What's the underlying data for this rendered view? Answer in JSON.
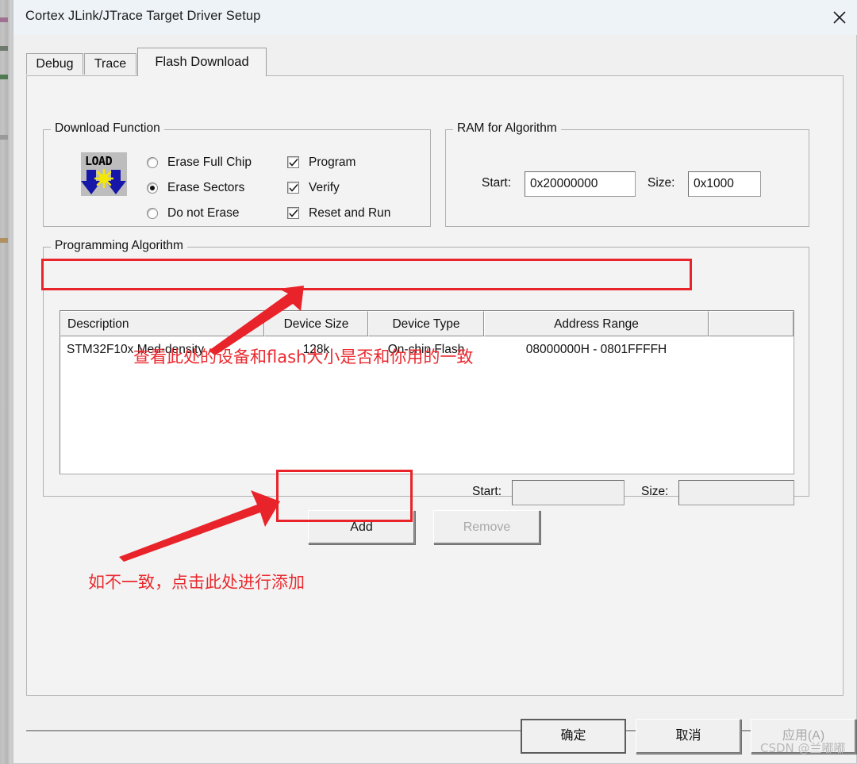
{
  "window": {
    "title": "Cortex JLink/JTrace Target Driver Setup",
    "close_icon": "close-icon"
  },
  "tabs": [
    {
      "label": "Debug",
      "active": false
    },
    {
      "label": "Trace",
      "active": false
    },
    {
      "label": "Flash Download",
      "active": true
    }
  ],
  "download_function": {
    "legend": "Download Function",
    "icon": {
      "name": "load-icon",
      "word": "LOAD"
    },
    "radios": [
      {
        "label": "Erase Full Chip",
        "selected": false
      },
      {
        "label": "Erase Sectors",
        "selected": true
      },
      {
        "label": "Do not Erase",
        "selected": false
      }
    ],
    "checkboxes": [
      {
        "label": "Program",
        "checked": true
      },
      {
        "label": "Verify",
        "checked": true
      },
      {
        "label": "Reset and Run",
        "checked": true
      }
    ]
  },
  "ram_for_algorithm": {
    "legend": "RAM for Algorithm",
    "start_label": "Start:",
    "start_value": "0x20000000",
    "size_label": "Size:",
    "size_value": "0x1000"
  },
  "programming_algorithm": {
    "legend": "Programming Algorithm",
    "columns": [
      "Description",
      "Device Size",
      "Device Type",
      "Address Range",
      ""
    ],
    "rows": [
      {
        "description": "STM32F10x Med-density ...",
        "device_size": "128k",
        "device_type": "On-chip Flash",
        "address_range": "08000000H - 0801FFFFH",
        "extra": ""
      }
    ],
    "start_label": "Start:",
    "start_value": "",
    "size_label": "Size:",
    "size_value": ""
  },
  "actions": {
    "add_label": "Add",
    "remove_label": "Remove"
  },
  "footer": {
    "ok_label": "确定",
    "cancel_label": "取消",
    "apply_label": "应用(A)",
    "watermark": "CSDN @兰嘟嘟"
  },
  "annotations": {
    "accent_color": "#e8232a",
    "note_row": "查看此处的设备和flash大小是否和你用的一致",
    "note_add": "如不一致，点击此处进行添加"
  }
}
